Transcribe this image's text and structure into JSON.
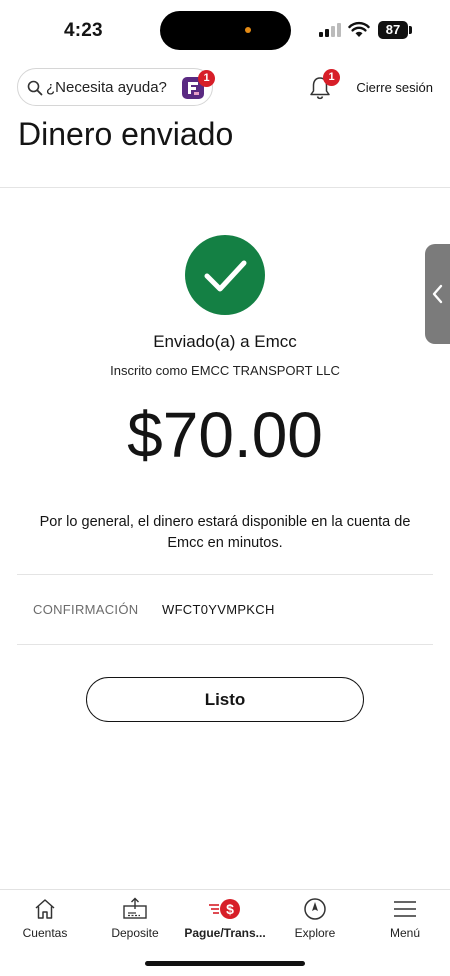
{
  "status_bar": {
    "time": "4:23",
    "battery": "87"
  },
  "header": {
    "help_placeholder": "¿Necesita ayuda?",
    "help_badge": "1",
    "notifications_badge": "1",
    "signout_label": "Cierre sesión"
  },
  "page": {
    "title": "Dinero enviado"
  },
  "confirmation": {
    "sent_to": "Enviado(a) a Emcc",
    "enrolled_as": "Inscrito como EMCC TRANSPORT LLC",
    "amount": "$70.00",
    "availability_message": "Por lo general, el dinero estará disponible en la cuenta de Emcc en minutos.",
    "confirmation_label": "CONFIRMACIÓN",
    "confirmation_code": "WFCT0YVMPKCH",
    "done_label": "Listo"
  },
  "bottom_nav": {
    "items": [
      {
        "label": "Cuentas",
        "icon": "home-icon"
      },
      {
        "label": "Deposite",
        "icon": "deposit-icon"
      },
      {
        "label": "Pague/Trans...",
        "icon": "pay-transfer-icon"
      },
      {
        "label": "Explore",
        "icon": "compass-icon"
      },
      {
        "label": "Menú",
        "icon": "menu-icon"
      }
    ]
  },
  "colors": {
    "success": "#148044",
    "badge": "#d71e28",
    "brand_purple": "#5a2a82"
  }
}
